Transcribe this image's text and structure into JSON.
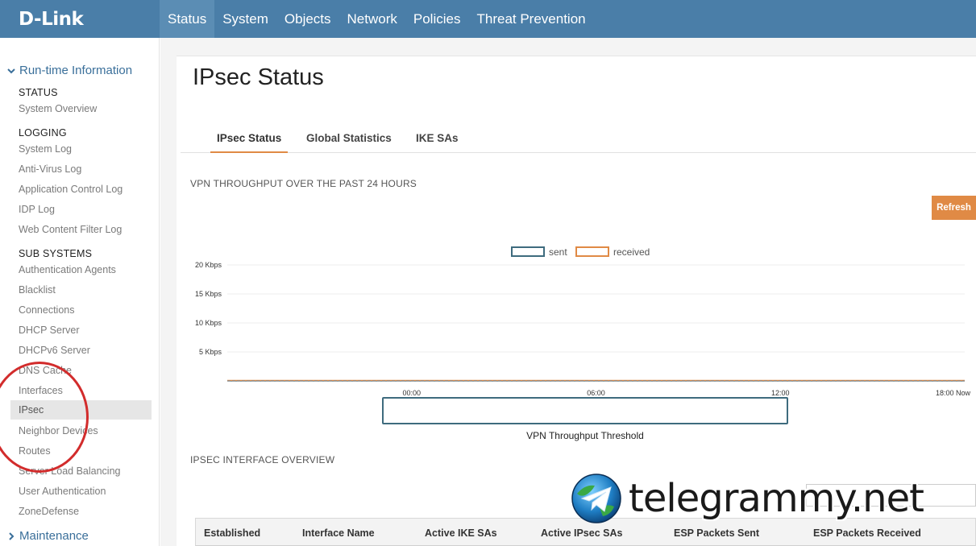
{
  "brand": {
    "logo_text": "D-Link"
  },
  "nav": {
    "items": [
      {
        "label": "Status",
        "active": true
      },
      {
        "label": "System"
      },
      {
        "label": "Objects"
      },
      {
        "label": "Network"
      },
      {
        "label": "Policies"
      },
      {
        "label": "Threat Prevention"
      }
    ]
  },
  "sidebar": {
    "runtime_label": "Run-time Information",
    "groups": {
      "status": {
        "label": "STATUS",
        "items": [
          "System Overview"
        ]
      },
      "logging": {
        "label": "LOGGING",
        "items": [
          "System Log",
          "Anti-Virus Log",
          "Application Control Log",
          "IDP Log",
          "Web Content Filter Log"
        ]
      },
      "subsystems": {
        "label": "SUB SYSTEMS",
        "items": [
          "Authentication Agents",
          "Blacklist",
          "Connections",
          "DHCP Server",
          "DHCPv6 Server",
          "DNS Cache",
          "Interfaces",
          "IPsec",
          "Neighbor Devices",
          "Routes",
          "Server Load Balancing",
          "User Authentication",
          "ZoneDefense"
        ],
        "selected": "IPsec"
      }
    },
    "maintenance_label": "Maintenance"
  },
  "page": {
    "title": "IPsec Status",
    "tabs": [
      {
        "label": "IPsec Status",
        "active": true
      },
      {
        "label": "Global Statistics"
      },
      {
        "label": "IKE SAs"
      }
    ],
    "throughput_title": "VPN THROUGHPUT OVER THE PAST 24 HOURS",
    "refresh_label": "Refresh",
    "threshold_label": "VPN Throughput Threshold",
    "interface_overview_title": "IPSEC INTERFACE OVERVIEW",
    "table_columns": [
      "Established",
      "Interface Name",
      "Active IKE SAs",
      "Active IPsec SAs",
      "ESP Packets Sent",
      "ESP Packets Received"
    ]
  },
  "chart_data": {
    "type": "line",
    "title": "",
    "xlabel": "",
    "ylabel": "",
    "y_ticks": [
      "20 Kbps",
      "15 Kbps",
      "10 Kbps",
      "5 Kbps"
    ],
    "y_tick_values": [
      20,
      15,
      10,
      5
    ],
    "ylim": [
      0,
      20
    ],
    "x_ticks": [
      "00:00",
      "06:00",
      "12:00",
      "18:00 Now"
    ],
    "x_tick_hours": [
      6,
      12,
      18,
      24
    ],
    "xlim": [
      0,
      24
    ],
    "grid": true,
    "legend_position": "top-center",
    "series": [
      {
        "name": "sent",
        "color": "#3e6b7e",
        "x": [
          0,
          24
        ],
        "values": [
          0,
          0
        ]
      },
      {
        "name": "received",
        "color": "#e08a45",
        "x": [
          0,
          24
        ],
        "values": [
          0,
          0
        ]
      }
    ]
  },
  "colors": {
    "header_bg": "#4a7ea8",
    "nav_active_bg": "#5b8db4",
    "accent_orange": "#e08a45",
    "sidebar_section": "#3a6f9a",
    "annotation_circle": "#d22c2c"
  },
  "overlay": {
    "watermark_text": "telegrammy.net"
  }
}
